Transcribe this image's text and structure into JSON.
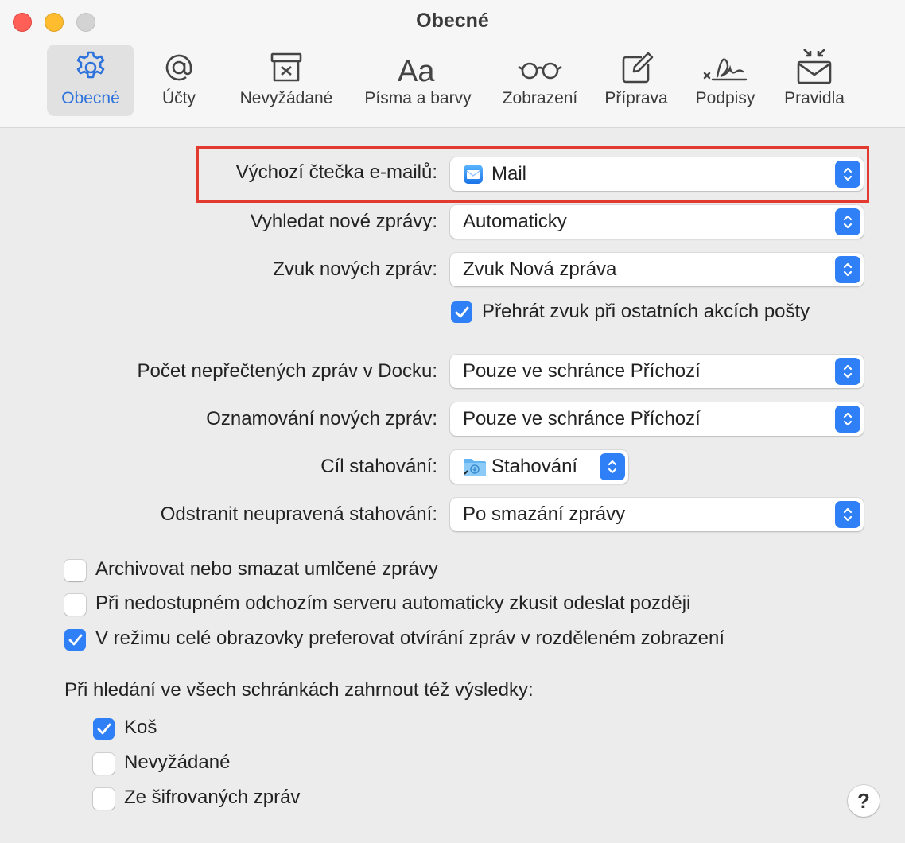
{
  "window": {
    "title": "Obecné"
  },
  "toolbar": {
    "items": [
      {
        "label": "Obecné",
        "icon": "gear-icon",
        "selected": true
      },
      {
        "label": "Účty",
        "icon": "at-icon"
      },
      {
        "label": "Nevyžádané",
        "icon": "junk-icon"
      },
      {
        "label": "Písma a barvy",
        "icon": "fonts-icon"
      },
      {
        "label": "Zobrazení",
        "icon": "glasses-icon"
      },
      {
        "label": "Příprava",
        "icon": "compose-icon"
      },
      {
        "label": "Podpisy",
        "icon": "signature-icon"
      },
      {
        "label": "Pravidla",
        "icon": "rules-icon"
      }
    ]
  },
  "settings": {
    "default_reader": {
      "label": "Výchozí čtečka e-mailů:",
      "value": "Mail"
    },
    "check_new": {
      "label": "Vyhledat nové zprávy:",
      "value": "Automaticky"
    },
    "new_sound": {
      "label": "Zvuk nových zpráv:",
      "value": "Zvuk Nová zpráva"
    },
    "play_sounds": {
      "label": "Přehrát zvuk při ostatních akcích pošty",
      "checked": true
    },
    "dock_count": {
      "label": "Počet nepřečtených zpráv v Docku:",
      "value": "Pouze ve schránce Příchozí"
    },
    "notifications": {
      "label": "Oznamování nových zpráv:",
      "value": "Pouze ve schránce Příchozí"
    },
    "download_folder": {
      "label": "Cíl stahování:",
      "value": "Stahování"
    },
    "remove_downloads": {
      "label": "Odstranit neupravená stahování:",
      "value": "Po smazání zprávy"
    }
  },
  "checkboxes": [
    {
      "label": "Archivovat nebo smazat umlčené zprávy",
      "checked": false
    },
    {
      "label": "Při nedostupném odchozím serveru automaticky zkusit odeslat později",
      "checked": false
    },
    {
      "label": "V režimu celé obrazovky preferovat otvírání zpráv v rozděleném zobrazení",
      "checked": true
    }
  ],
  "search": {
    "heading": "Při hledání ve všech schránkách zahrnout též výsledky:",
    "options": [
      {
        "label": "Koš",
        "checked": true
      },
      {
        "label": "Nevyžádané",
        "checked": false
      },
      {
        "label": "Ze šifrovaných zpráv",
        "checked": false
      }
    ]
  },
  "help": {
    "label": "?"
  },
  "colors": {
    "accent": "#2f7ff6",
    "highlight": "#e33a2f",
    "selected_label": "#2e73dc"
  }
}
